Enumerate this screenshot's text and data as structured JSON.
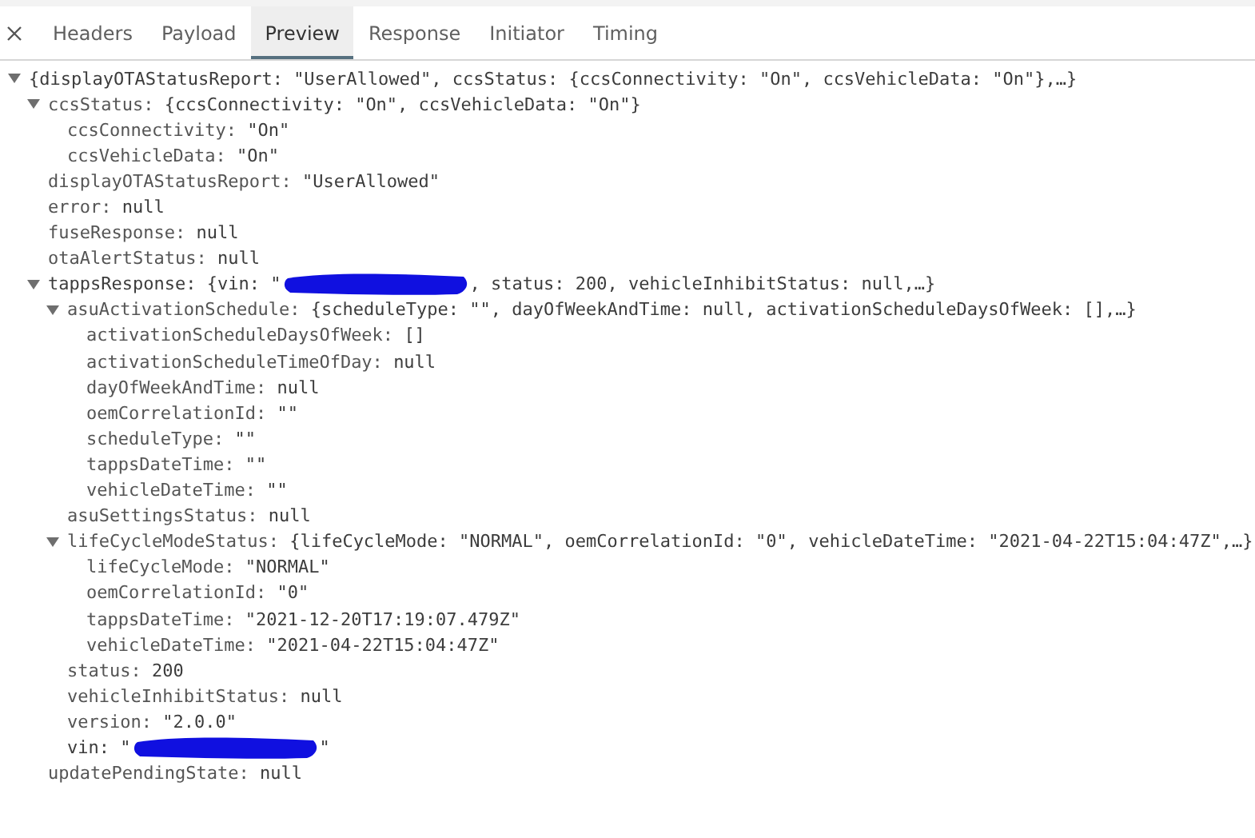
{
  "tabs": [
    {
      "label": "Headers",
      "selected": false
    },
    {
      "label": "Payload",
      "selected": false
    },
    {
      "label": "Preview",
      "selected": true
    },
    {
      "label": "Response",
      "selected": false
    },
    {
      "label": "Initiator",
      "selected": false
    },
    {
      "label": "Timing",
      "selected": false
    }
  ],
  "tree": {
    "value": "{displayOTAStatusReport: \"UserAllowed\", ccsStatus: {ccsConnectivity: \"On\", ccsVehicleData: \"On\"},…}",
    "expanded": true,
    "children": [
      {
        "key": "ccsStatus:",
        "value": "{ccsConnectivity: \"On\", ccsVehicleData: \"On\"}",
        "expanded": true,
        "children": [
          {
            "key": "ccsConnectivity:",
            "value": "\"On\""
          },
          {
            "key": "ccsVehicleData:",
            "value": "\"On\""
          }
        ]
      },
      {
        "key": "displayOTAStatusReport:",
        "value": "\"UserAllowed\""
      },
      {
        "key": "error:",
        "value": "null"
      },
      {
        "key": "fuseResponse:",
        "value": "null"
      },
      {
        "key": "otaAlertStatus:",
        "value": "null"
      },
      {
        "key": "tappsResponse:",
        "value_parts": [
          {
            "kind": "text",
            "text": "{vin: \""
          },
          {
            "kind": "redaction"
          },
          {
            "kind": "text",
            "text": ", status: 200, vehicleInhibitStatus: null,…}"
          }
        ],
        "expanded": true,
        "children": [
          {
            "key": "asuActivationSchedule:",
            "value": "{scheduleType: \"\", dayOfWeekAndTime: null, activationScheduleDaysOfWeek: [],…}",
            "expanded": true,
            "children": [
              {
                "key": "activationScheduleDaysOfWeek:",
                "value": "[]"
              },
              {
                "key": "activationScheduleTimeOfDay:",
                "value": "null"
              },
              {
                "key": "dayOfWeekAndTime:",
                "value": "null"
              },
              {
                "key": "oemCorrelationId:",
                "value": "\"\""
              },
              {
                "key": "scheduleType:",
                "value": "\"\""
              },
              {
                "key": "tappsDateTime:",
                "value": "\"\""
              },
              {
                "key": "vehicleDateTime:",
                "value": "\"\""
              }
            ]
          },
          {
            "key": "asuSettingsStatus:",
            "value": "null"
          },
          {
            "key": "lifeCycleModeStatus:",
            "value": "{lifeCycleMode: \"NORMAL\", oemCorrelationId: \"0\", vehicleDateTime: \"2021-04-22T15:04:47Z\",…}",
            "expanded": true,
            "children": [
              {
                "key": "lifeCycleMode:",
                "value": "\"NORMAL\""
              },
              {
                "key": "oemCorrelationId:",
                "value": "\"0\""
              },
              {
                "key": "tappsDateTime:",
                "value": "\"2021-12-20T17:19:07.479Z\""
              },
              {
                "key": "vehicleDateTime:",
                "value": "\"2021-04-22T15:04:47Z\""
              }
            ]
          },
          {
            "key": "status:",
            "value": "200"
          },
          {
            "key": "vehicleInhibitStatus:",
            "value": "null"
          },
          {
            "key": "version:",
            "value": "\"2.0.0\""
          },
          {
            "key": "vin:",
            "value_parts": [
              {
                "kind": "text",
                "text": "\""
              },
              {
                "kind": "redaction"
              },
              {
                "kind": "text",
                "text": "\""
              }
            ]
          }
        ]
      },
      {
        "key": "updatePendingState:",
        "value": "null"
      }
    ]
  }
}
